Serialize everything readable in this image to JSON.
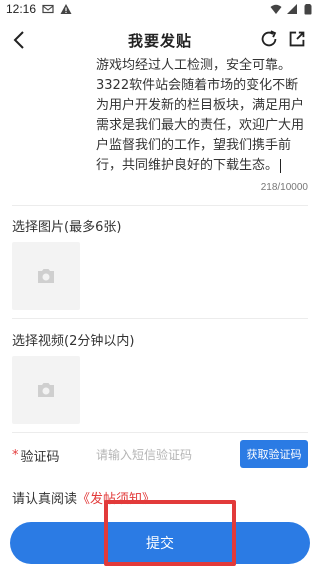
{
  "status_bar": {
    "time": "12:16",
    "icons": [
      "mail-icon",
      "warning-icon",
      "wifi-icon",
      "signal-icon",
      "battery-icon"
    ]
  },
  "header": {
    "title": "我要发贴",
    "back_icon": "chevron-left-icon",
    "refresh_icon": "refresh-icon",
    "share_icon": "share-icon"
  },
  "post": {
    "content": "游戏均经过人工检测，安全可靠。3322软件站会随着市场的变化不断为用户开发新的栏目板块，满足用户需求是我们最大的责任，欢迎广大用户监督我们的工作，望我们携手前行，共同维护良好的下载生态。",
    "counter": "218/10000"
  },
  "images": {
    "label": "选择图片(最多6张)",
    "upload_icon": "camera-icon"
  },
  "video": {
    "label": "选择视频(2分钟以内)",
    "upload_icon": "camera-icon"
  },
  "verification": {
    "required_mark": "*",
    "label": "验证码",
    "placeholder": "请输入短信验证码",
    "button": "获取验证码"
  },
  "notice": {
    "prefix": "请认真阅读",
    "link": "《发帖须知》"
  },
  "submit": {
    "label": "提交"
  },
  "colors": {
    "accent": "#2b7be4",
    "highlight": "#e23a3a"
  }
}
